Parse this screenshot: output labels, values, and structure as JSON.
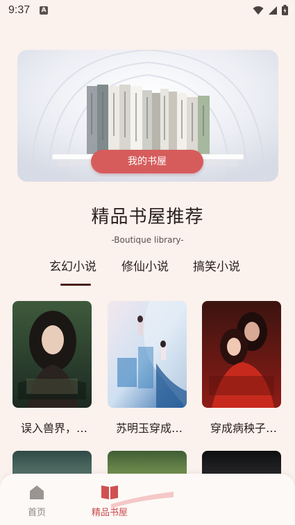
{
  "status_bar": {
    "time": "9:37"
  },
  "banner": {
    "button_label": "我的书屋"
  },
  "section": {
    "title": "精品书屋推荐",
    "subtitle": "-Boutique library-"
  },
  "tabs": [
    {
      "label": "玄幻小说",
      "active": true
    },
    {
      "label": "修仙小说",
      "active": false
    },
    {
      "label": "搞笑小说",
      "active": false
    }
  ],
  "books": [
    {
      "title": "误入兽界，…"
    },
    {
      "title": "苏明玉穿成…"
    },
    {
      "title": "穿成病秧子…"
    }
  ],
  "bottom_nav": [
    {
      "label": "首页",
      "icon": "home-icon",
      "active": false
    },
    {
      "label": "精品书屋",
      "icon": "book-icon",
      "active": true
    }
  ],
  "colors": {
    "accent": "#d65c5c",
    "tab_underline": "#4a1c12",
    "background": "#fbf1ed"
  }
}
